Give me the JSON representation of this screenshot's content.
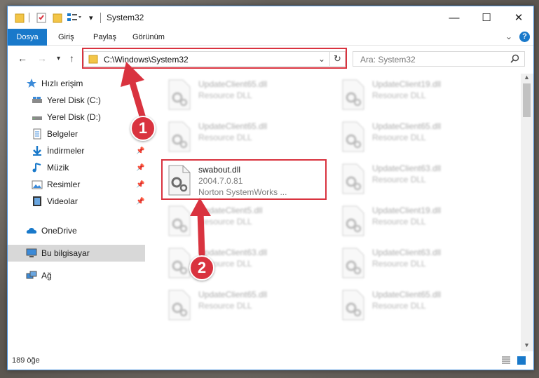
{
  "window": {
    "title": "System32"
  },
  "ribbon": {
    "tabs": [
      "Dosya",
      "Giriş",
      "Paylaş",
      "Görünüm"
    ]
  },
  "address": {
    "path": "C:\\Windows\\System32"
  },
  "search": {
    "placeholder": "Ara: System32"
  },
  "navpane": {
    "items": [
      {
        "label": "Hızlı erişim",
        "icon": "star-icon",
        "pinned": false
      },
      {
        "label": "Yerel Disk (C:)",
        "icon": "drive-icon",
        "pinned": false
      },
      {
        "label": "Yerel Disk (D:)",
        "icon": "drive-icon",
        "pinned": false
      },
      {
        "label": "Belgeler",
        "icon": "documents-icon",
        "pinned": false
      },
      {
        "label": "İndirmeler",
        "icon": "download-icon",
        "pinned": true
      },
      {
        "label": "Müzik",
        "icon": "music-icon",
        "pinned": true
      },
      {
        "label": "Resimler",
        "icon": "pictures-icon",
        "pinned": true
      },
      {
        "label": "Videolar",
        "icon": "video-icon",
        "pinned": true
      },
      {
        "label": "OneDrive",
        "icon": "cloud-icon",
        "pinned": false
      },
      {
        "label": "Bu bilgisayar",
        "icon": "computer-icon",
        "pinned": false,
        "selected": true
      },
      {
        "label": "Ağ",
        "icon": "network-icon",
        "pinned": false
      }
    ]
  },
  "files": {
    "left": [
      {
        "name": "UpdateClient65.dll",
        "line1": "Resource DLL",
        "line2": "",
        "blurred": true
      },
      {
        "name": "UpdateClient65.dll",
        "line1": "Resource DLL",
        "line2": "",
        "blurred": true
      },
      {
        "name": "swabout.dll",
        "line1": "2004.7.0.81",
        "line2": "Norton SystemWorks ...",
        "blurred": false
      },
      {
        "name": "UpdateClient5.dll",
        "line1": "Resource DLL",
        "line2": "",
        "blurred": true
      },
      {
        "name": "UpdateClient63.dll",
        "line1": "Resource DLL",
        "line2": "",
        "blurred": true
      },
      {
        "name": "UpdateClient65.dll",
        "line1": "Resource DLL",
        "line2": "",
        "blurred": true
      }
    ],
    "right": [
      {
        "name": "UpdateClient19.dll",
        "line1": "Resource DLL",
        "line2": "",
        "blurred": true
      },
      {
        "name": "UpdateClient65.dll",
        "line1": "Resource DLL",
        "line2": "",
        "blurred": true
      },
      {
        "name": "UpdateClient63.dll",
        "line1": "Resource DLL",
        "line2": "",
        "blurred": true
      },
      {
        "name": "UpdateClient19.dll",
        "line1": "Resource DLL",
        "line2": "",
        "blurred": true
      },
      {
        "name": "UpdateClient63.dll",
        "line1": "Resource DLL",
        "line2": "",
        "blurred": true
      },
      {
        "name": "UpdateClient65.dll",
        "line1": "Resource DLL",
        "line2": "",
        "blurred": true
      }
    ]
  },
  "status": {
    "count": "189 öğe"
  },
  "annotations": {
    "badge1": "1",
    "badge2": "2",
    "color": "#d9333f"
  },
  "colors": {
    "accent": "#1979ca"
  }
}
